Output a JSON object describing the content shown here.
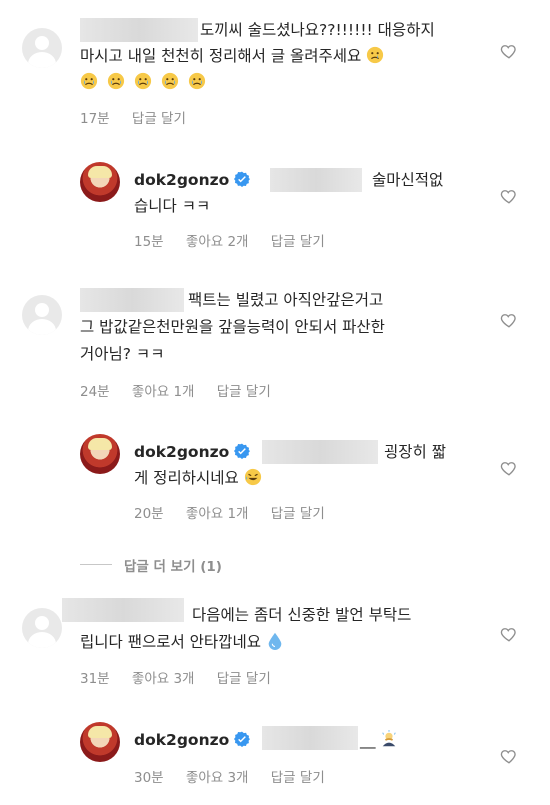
{
  "comments": [
    {
      "line1": "도끼씨 술드셨나요??!!!!!! 대응하지",
      "line2": "마시고 내일 천천히 정리해서 글 올려주세요",
      "time": "17분",
      "reply": "답글 달기",
      "reply_item": {
        "username": "dok2gonzo",
        "line1": "술마신적없",
        "line2": "습니다 ㅋㅋ",
        "time": "15분",
        "likes": "좋아요 2개",
        "reply": "답글 달기"
      }
    },
    {
      "line1": "팩트는 빌렸고 아직안갚은거고",
      "line2": "그 밥값같은천만원을 갚을능력이 안되서 파산한",
      "line3": "거아님? ㅋㅋ",
      "time": "24분",
      "likes": "좋아요 1개",
      "reply": "답글 달기",
      "reply_item": {
        "username": "dok2gonzo",
        "line1": "굉장히 짧",
        "line2": "게 정리하시네요",
        "time": "20분",
        "likes": "좋아요 1개",
        "reply": "답글 달기"
      },
      "more_replies": "답글 더 보기 (1)"
    },
    {
      "line1": "다음에는 좀더 신중한 발언 부탁드",
      "line2": "립니다 팬으로서 안타깝네요",
      "time": "31분",
      "likes": "좋아요 3개",
      "reply": "답글 달기",
      "reply_item": {
        "username": "dok2gonzo",
        "line1": "__",
        "time": "30분",
        "likes": "좋아요 3개",
        "reply": "답글 달기"
      }
    }
  ],
  "icons": {
    "heart": "heart-icon",
    "verified": "verified-badge-icon",
    "verified_color": "#3897f0"
  }
}
